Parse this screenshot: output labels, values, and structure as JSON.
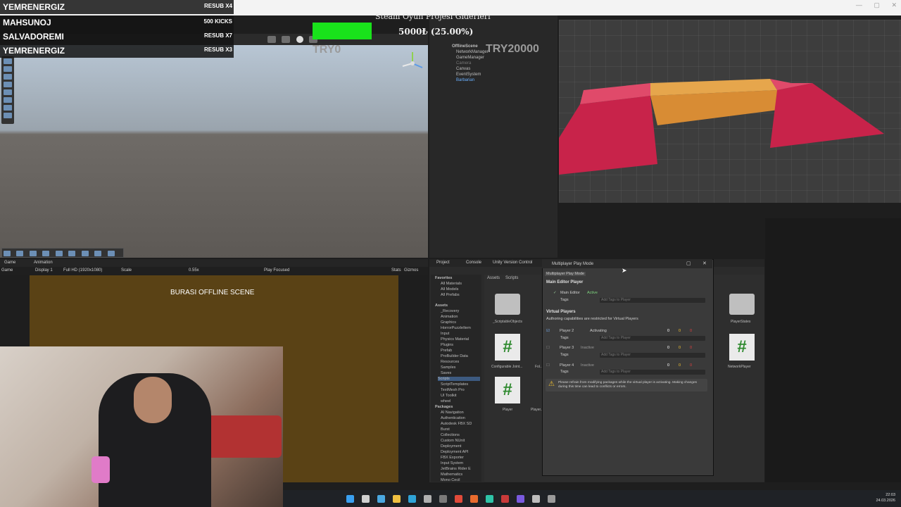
{
  "overlay": {
    "leaderboard": [
      {
        "name": "YEMRENERGIZ",
        "value": "RESUB X4"
      },
      {
        "name": "MAHSUNOJ",
        "value": "500 KICKS"
      },
      {
        "name": "SALVADOREMI",
        "value": "RESUB X7"
      },
      {
        "name": "YEMRENERGIZ",
        "value": "RESUB X3"
      }
    ],
    "goal_title": "Steam Oyun Projesi Giderleri",
    "goal_progress_fraction": 0.25,
    "goal_text": "5000₺ (25.00%)",
    "goal_left": "TRY0",
    "goal_right": "TRY20000"
  },
  "hierarchy": {
    "items": [
      "OfflineScene",
      "NetworkManager",
      "GameManager",
      "Camera",
      "Canvas",
      "EventSystem",
      "Barbarian"
    ]
  },
  "game_panel": {
    "tabs": [
      "Game",
      "Animation"
    ],
    "display": "Display 1",
    "resolution": "Full HD (1920x1080)",
    "scale_label": "Scale",
    "scale_value": "0.55x",
    "play_focused": "Play Focused",
    "stats": "Stats",
    "gizmos": "Gizmos",
    "game_dropdown": "Game",
    "canvas_text": "BURASI OFFLINE SCENE"
  },
  "project_panel": {
    "tabs": [
      "Project",
      "Console",
      "Unity Version Control"
    ],
    "breadcrumb": [
      "Assets",
      "Scripts"
    ],
    "favorites_header": "Favorites",
    "favorites": [
      "All Materials",
      "All Models",
      "All Prefabs"
    ],
    "assets_header": "Assets",
    "assets": [
      "_Recovery",
      "Animation",
      "Graphics",
      "HorrorPuzzleItem",
      "Input",
      "Physics Material",
      "Plugins",
      "Prefab",
      "ProBuilder Data",
      "Resources",
      "Samples",
      "Saves",
      "Scripts",
      "ScriptTemplates",
      "TextMesh Pro",
      "UI Toolkit",
      "wheel"
    ],
    "packages_header": "Packages",
    "packages": [
      "AI Navigation",
      "Authentication",
      "Autodesk FBX SD",
      "Burst",
      "Collections",
      "Custom NUnit",
      "Deployment",
      "Deployment API",
      "FBX Exporter",
      "Input System",
      "JetBrains Rider E",
      "Mathematics",
      "Mono Cecil"
    ],
    "grid_items": [
      "_ScriptableObjects",
      "Configurable Joint...",
      "Player",
      "PlayerStates",
      "NetworkPlayer",
      "Fol...",
      "Player..."
    ]
  },
  "mppm": {
    "title": "Multiplayer Play Mode",
    "tab": "Multiplayer Play Mode",
    "main_header": "Main Editor Player",
    "main_player": "Main Editor",
    "main_status": "Active",
    "tags_label": "Tags",
    "tags_placeholder": "Add Tags to Player",
    "virtual_header": "Virtual Players",
    "virtual_note": "Authoring capabilities are restricted for Virtual Players",
    "players": [
      {
        "name": "Player 2",
        "status": "Activating",
        "checked": true
      },
      {
        "name": "Player 3",
        "status": "Inactive",
        "checked": false
      },
      {
        "name": "Player 4",
        "status": "Inactive",
        "checked": false
      }
    ],
    "counts": [
      "0",
      "0",
      "0"
    ],
    "warning": "Please refrain from modifying packages while the virtual player is activating. Making changes during this time can lead to conflicts or errors."
  },
  "taskbar": {
    "time": "22:03",
    "date": "24.03.2026"
  },
  "colors": {
    "goal_bar": "#19e21b",
    "game_canvas": "#5a4215",
    "platform_red": "#d42b4f",
    "platform_orange": "#d88c34"
  }
}
